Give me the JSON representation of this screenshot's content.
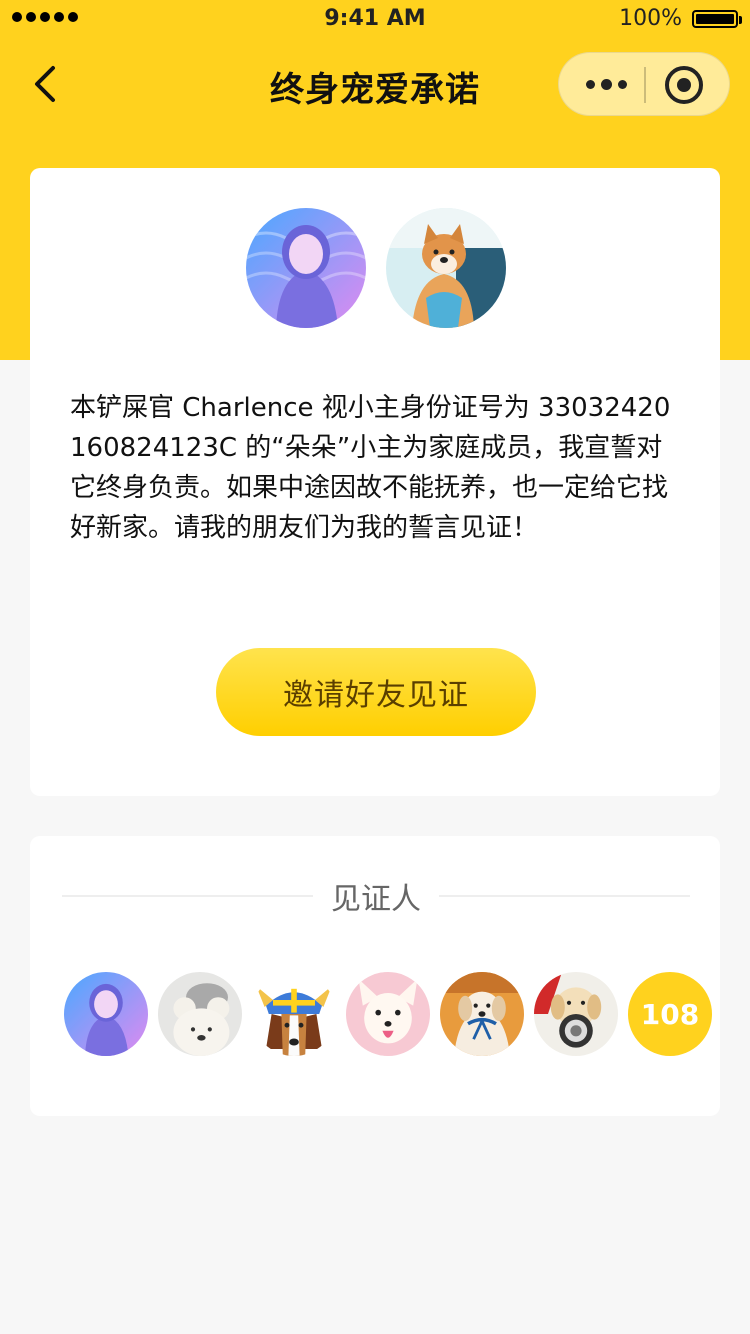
{
  "status_bar": {
    "time": "9:41 AM",
    "battery": "100%"
  },
  "nav": {
    "title": "终身宠爱承诺"
  },
  "pledge": {
    "text": "本铲屎官 Charlence 视小主身份证号为 330324201608241­23C 的“朵朵”小主为家庭成员，我宣誓对它终身负责。如果中途因故不能抚养，也一定给它找好新家。请我的朋友们为我的誓言见证！",
    "invite_label": "邀请好友见证"
  },
  "witness": {
    "heading": "见证人",
    "count": "108"
  },
  "colors": {
    "brand_yellow": "#ffd21e",
    "page_background": "#f7f7f7"
  }
}
